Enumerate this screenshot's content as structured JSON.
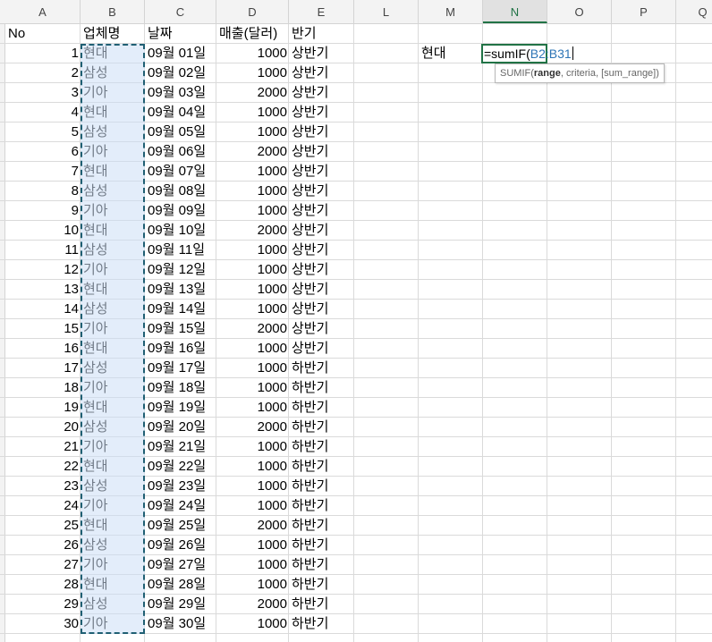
{
  "columns": [
    {
      "label": "A",
      "active": false
    },
    {
      "label": "B",
      "active": false
    },
    {
      "label": "C",
      "active": false
    },
    {
      "label": "D",
      "active": false
    },
    {
      "label": "E",
      "active": false
    },
    {
      "label": "L",
      "active": false
    },
    {
      "label": "M",
      "active": false
    },
    {
      "label": "N",
      "active": true
    },
    {
      "label": "O",
      "active": false
    },
    {
      "label": "P",
      "active": false
    },
    {
      "label": "Q",
      "active": false
    }
  ],
  "headers": {
    "no": "No",
    "company": "업체명",
    "date": "날짜",
    "sales": "매출(달러)",
    "half": "반기"
  },
  "rows": [
    {
      "no": "1",
      "company": "현대",
      "date": "09월 01일",
      "sales": "1000",
      "half": "상반기"
    },
    {
      "no": "2",
      "company": "삼성",
      "date": "09월 02일",
      "sales": "1000",
      "half": "상반기"
    },
    {
      "no": "3",
      "company": "기아",
      "date": "09월 03일",
      "sales": "2000",
      "half": "상반기"
    },
    {
      "no": "4",
      "company": "현대",
      "date": "09월 04일",
      "sales": "1000",
      "half": "상반기"
    },
    {
      "no": "5",
      "company": "삼성",
      "date": "09월 05일",
      "sales": "1000",
      "half": "상반기"
    },
    {
      "no": "6",
      "company": "기아",
      "date": "09월 06일",
      "sales": "2000",
      "half": "상반기"
    },
    {
      "no": "7",
      "company": "현대",
      "date": "09월 07일",
      "sales": "1000",
      "half": "상반기"
    },
    {
      "no": "8",
      "company": "삼성",
      "date": "09월 08일",
      "sales": "1000",
      "half": "상반기"
    },
    {
      "no": "9",
      "company": "기아",
      "date": "09월 09일",
      "sales": "1000",
      "half": "상반기"
    },
    {
      "no": "10",
      "company": "현대",
      "date": "09월 10일",
      "sales": "2000",
      "half": "상반기"
    },
    {
      "no": "11",
      "company": "삼성",
      "date": "09월 11일",
      "sales": "1000",
      "half": "상반기"
    },
    {
      "no": "12",
      "company": "기아",
      "date": "09월 12일",
      "sales": "1000",
      "half": "상반기"
    },
    {
      "no": "13",
      "company": "현대",
      "date": "09월 13일",
      "sales": "1000",
      "half": "상반기"
    },
    {
      "no": "14",
      "company": "삼성",
      "date": "09월 14일",
      "sales": "1000",
      "half": "상반기"
    },
    {
      "no": "15",
      "company": "기아",
      "date": "09월 15일",
      "sales": "2000",
      "half": "상반기"
    },
    {
      "no": "16",
      "company": "현대",
      "date": "09월 16일",
      "sales": "1000",
      "half": "상반기"
    },
    {
      "no": "17",
      "company": "삼성",
      "date": "09월 17일",
      "sales": "1000",
      "half": "하반기"
    },
    {
      "no": "18",
      "company": "기아",
      "date": "09월 18일",
      "sales": "1000",
      "half": "하반기"
    },
    {
      "no": "19",
      "company": "현대",
      "date": "09월 19일",
      "sales": "1000",
      "half": "하반기"
    },
    {
      "no": "20",
      "company": "삼성",
      "date": "09월 20일",
      "sales": "2000",
      "half": "하반기"
    },
    {
      "no": "21",
      "company": "기아",
      "date": "09월 21일",
      "sales": "1000",
      "half": "하반기"
    },
    {
      "no": "22",
      "company": "현대",
      "date": "09월 22일",
      "sales": "1000",
      "half": "하반기"
    },
    {
      "no": "23",
      "company": "삼성",
      "date": "09월 23일",
      "sales": "1000",
      "half": "하반기"
    },
    {
      "no": "24",
      "company": "기아",
      "date": "09월 24일",
      "sales": "1000",
      "half": "하반기"
    },
    {
      "no": "25",
      "company": "현대",
      "date": "09월 25일",
      "sales": "2000",
      "half": "하반기"
    },
    {
      "no": "26",
      "company": "삼성",
      "date": "09월 26일",
      "sales": "1000",
      "half": "하반기"
    },
    {
      "no": "27",
      "company": "기아",
      "date": "09월 27일",
      "sales": "1000",
      "half": "하반기"
    },
    {
      "no": "28",
      "company": "현대",
      "date": "09월 28일",
      "sales": "1000",
      "half": "하반기"
    },
    {
      "no": "29",
      "company": "삼성",
      "date": "09월 29일",
      "sales": "2000",
      "half": "하반기"
    },
    {
      "no": "30",
      "company": "기아",
      "date": "09월 30일",
      "sales": "1000",
      "half": "하반기"
    }
  ],
  "criteria_cell": "현대",
  "formula": {
    "prefix": "=sumIF(",
    "reference": "B2:B31"
  },
  "tooltip": {
    "func": "SUMIF(",
    "arg_bold": "range",
    "rest": ", criteria, [sum_range])"
  },
  "colors": {
    "accent": "#217346",
    "range_border": "#1f5f73",
    "range_fill": "#dce8f7",
    "reference_text": "#2e75b6"
  }
}
